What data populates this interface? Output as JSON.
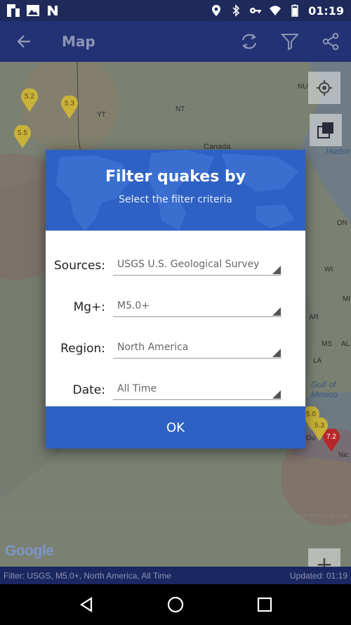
{
  "statusbar": {
    "time": "01:19",
    "left_icons": [
      "flipboard-icon",
      "image-icon",
      "n-icon"
    ],
    "right_icons": [
      "location-icon",
      "bluetooth-icon",
      "key-icon",
      "wifi-icon",
      "battery-icon"
    ]
  },
  "appbar": {
    "title": "Map",
    "back_icon": "arrow-left-icon",
    "actions": [
      "refresh-icon",
      "filter-icon",
      "share-icon"
    ]
  },
  "map": {
    "labels": [
      {
        "text": "YT"
      },
      {
        "text": "NT"
      },
      {
        "text": "NU"
      },
      {
        "text": "Canada"
      },
      {
        "text": "Hudso"
      },
      {
        "text": "ON"
      },
      {
        "text": "WI"
      },
      {
        "text": "MI"
      },
      {
        "text": "AR"
      },
      {
        "text": "MS"
      },
      {
        "text": "AL"
      },
      {
        "text": "LA"
      },
      {
        "text": "Gulf of"
      },
      {
        "text": "Mexico"
      },
      {
        "text": "Gu"
      },
      {
        "text": "Nic"
      }
    ],
    "pins": [
      {
        "mag": "5.2",
        "color": "yellow"
      },
      {
        "mag": "5.3",
        "color": "yellow"
      },
      {
        "mag": "5.5",
        "color": "yellow"
      },
      {
        "mag": "7.2",
        "color": "red"
      },
      {
        "mag": "5.3",
        "color": "yellow"
      },
      {
        "mag": "5.0",
        "color": "yellow"
      }
    ],
    "zoom_in": "+",
    "zoom_out": "−",
    "logo": "Google"
  },
  "dialog": {
    "title": "Filter quakes by",
    "subtitle": "Select the filter criteria",
    "rows": [
      {
        "label": "Sources:",
        "value": "USGS U.S. Geological Survey"
      },
      {
        "label": "Mg+:",
        "value": "M5.0+"
      },
      {
        "label": "Region:",
        "value": "North America"
      },
      {
        "label": "Date:",
        "value": "All Time"
      }
    ],
    "ok_label": "OK"
  },
  "footer": {
    "filter_text": "Filter: USGS, M5.0+, North America, All Time",
    "updated_text": "Updated: 01:19"
  },
  "colors": {
    "primary": "#233274",
    "accent": "#2e61c3",
    "statusbar": "#1d2a5a"
  }
}
